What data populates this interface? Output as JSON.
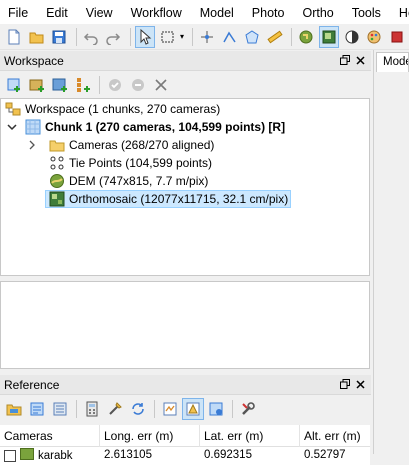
{
  "menubar": {
    "items": [
      "File",
      "Edit",
      "View",
      "Workflow",
      "Model",
      "Photo",
      "Ortho",
      "Tools",
      "Help"
    ]
  },
  "workspace_panel": {
    "title": "Workspace",
    "tree": {
      "root": "Workspace (1 chunks, 270 cameras)",
      "chunk": "Chunk 1 (270 cameras, 104,599 points) [R]",
      "children": [
        "Cameras (268/270 aligned)",
        "Tie Points (104,599 points)",
        "DEM (747x815, 7.7 m/pix)",
        "Orthomosaic (12077x11715, 32.1 cm/pix)"
      ]
    }
  },
  "right_panel": {
    "tab_label": "Model"
  },
  "reference_panel": {
    "title": "Reference",
    "columns": [
      "Cameras",
      "Long. err (m)",
      "Lat. err (m)",
      "Alt. err (m)"
    ],
    "rows": [
      {
        "camera": "karabk",
        "long_err": "2.613105",
        "lat_err": "0.692315",
        "alt_err": "0.52797"
      }
    ]
  },
  "colors": {
    "selection": "#cce8ff",
    "chunk_icon": "#4a90d9"
  }
}
